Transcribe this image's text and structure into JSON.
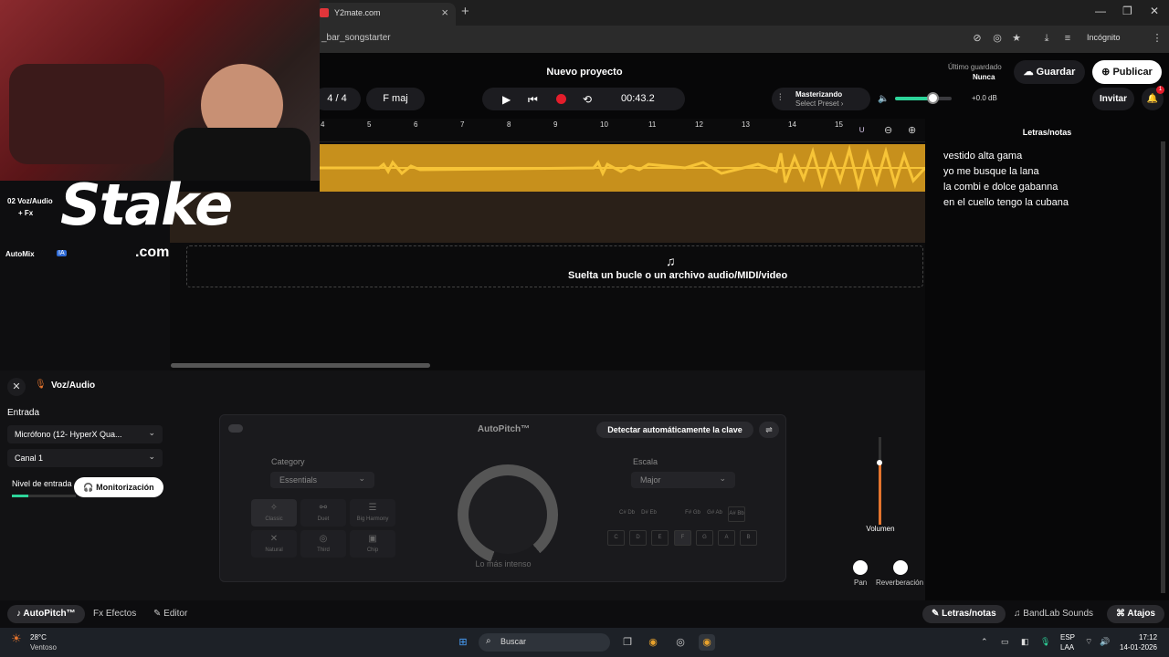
{
  "browser": {
    "tab_title": "Y2mate.com",
    "url": "_bar_songstarter",
    "incognito_label": "Incógnito"
  },
  "header": {
    "project_title": "Nuevo proyecto",
    "time_signature": "4 / 4",
    "key": "F maj",
    "time": "00:43.2",
    "mastering_label": "Masterizando",
    "mastering_preset": "Select Preset ›",
    "volume_db": "+0.0 dB",
    "volume_level": 0.6,
    "last_saved_label": "Último guardado",
    "last_saved_value": "Nunca",
    "save_label": "Guardar",
    "publish_label": "Publicar",
    "invite_label": "Invitar",
    "notification_count": "1"
  },
  "ruler": {
    "ticks": [
      "4",
      "5",
      "6",
      "7",
      "8",
      "9",
      "10",
      "11",
      "12",
      "13",
      "14",
      "15"
    ]
  },
  "track": {
    "name": "02  Voz/Audio",
    "fx_label": "+ Fx",
    "automix_label": "AutoMix",
    "ia_badge": "IA"
  },
  "dropzone_text": "Suelta un bucle o un archivo audio/MIDI/video",
  "overlay": {
    "brand": "Stake",
    "brand_suffix": ".com"
  },
  "lyrics": {
    "title": "Letras/notas",
    "lines": [
      "vestido alta gama",
      "yo me busque la lana",
      "la combi e dolce gabanna",
      "en el cuello tengo la cubana"
    ]
  },
  "bottom_panel": {
    "title": "Voz/Audio",
    "input_label": "Entrada",
    "input_device": "Micrófono (12- HyperX Qua...",
    "channel": "Canal 1",
    "level_label": "Nivel de entrada",
    "monitor_label": "Monitorización",
    "autopitch": {
      "title": "AutoPitch™",
      "detect_label": "Detectar automáticamente la clave",
      "category_label": "Category",
      "category_value": "Essentials",
      "scale_label": "Escala",
      "scale_value": "Major",
      "knob_label": "Lo más intenso",
      "styles": [
        "Classic",
        "Duet",
        "Big Harmony",
        "Natural",
        "Third",
        "Chip"
      ],
      "sharps": [
        "C#\nDb",
        "D#\nEb",
        "F#\nGb",
        "G#\nAb",
        "A#\nBb"
      ],
      "notes": [
        "C",
        "D",
        "E",
        "F",
        "G",
        "A",
        "B"
      ]
    },
    "volume_label": "Volumen",
    "pan_label": "Pan",
    "reverb_label": "Reverberación"
  },
  "footer_tabs": {
    "autopitch": "AutoPitch™",
    "effects": "Efectos",
    "editor": "Editor",
    "lyrics": "Letras/notas",
    "sounds": "BandLab Sounds",
    "shortcuts": "Atajos"
  },
  "taskbar": {
    "temperature": "28°C",
    "weather": "Ventoso",
    "search_placeholder": "Buscar",
    "lang1": "ESP",
    "lang2": "LAA",
    "time": "17:12",
    "date": "14-01-2026"
  }
}
